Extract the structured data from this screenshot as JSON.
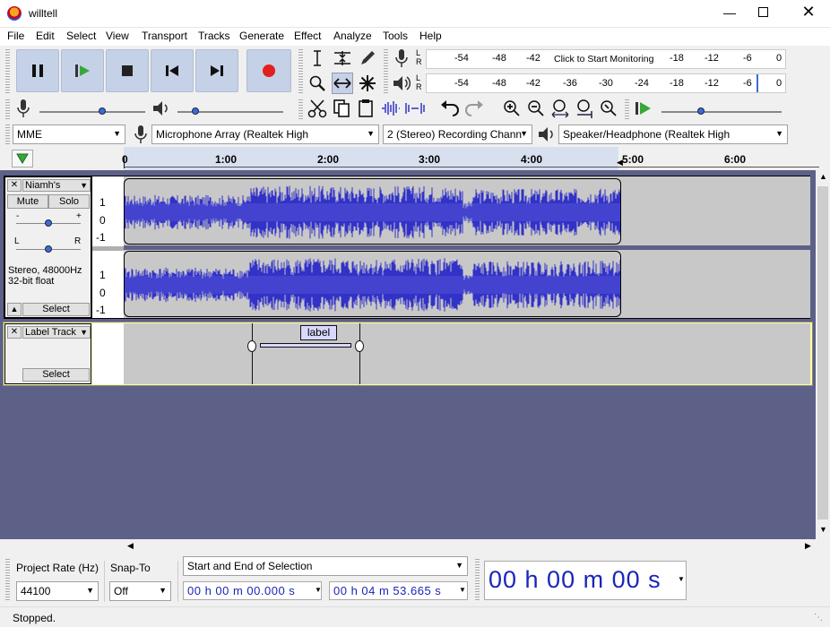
{
  "window": {
    "title": "willtell"
  },
  "menu": [
    "File",
    "Edit",
    "Select",
    "View",
    "Transport",
    "Tracks",
    "Generate",
    "Effect",
    "Analyze",
    "Tools",
    "Help"
  ],
  "meters": {
    "record_ticks": [
      "-54",
      "-48",
      "-42",
      "Click to Start Monitoring",
      "-18",
      "-12",
      "-6",
      "0"
    ],
    "playback_ticks": [
      "-54",
      "-48",
      "-42",
      "-36",
      "-30",
      "-24",
      "-18",
      "-12",
      "-6",
      "0"
    ],
    "channels": [
      "L",
      "R"
    ]
  },
  "devices": {
    "host": "MME",
    "mic": "Microphone Array (Realtek High",
    "channels": "2 (Stereo) Recording Chann",
    "speaker": "Speaker/Headphone (Realtek High"
  },
  "ruler": {
    "labels": [
      "0",
      "1:00",
      "2:00",
      "3:00",
      "4:00",
      "5:00",
      "6:00"
    ]
  },
  "audio_track": {
    "name": "Niamh's",
    "mute": "Mute",
    "solo": "Solo",
    "info1": "Stereo, 48000Hz",
    "info2": "32-bit float",
    "select": "Select",
    "gain_minus": "-",
    "gain_plus": "+",
    "pan_left": "L",
    "pan_right": "R",
    "scale": [
      "1",
      "0",
      "-1"
    ]
  },
  "label_track": {
    "name": "Label Track",
    "select": "Select",
    "label_text": "label"
  },
  "selection": {
    "rate_label": "Project Rate (Hz)",
    "rate": "44100",
    "snap_label": "Snap-To",
    "snap": "Off",
    "mode": "Start and End of Selection",
    "start": "00 h 00 m 00.000 s",
    "end": "00 h 04 m 53.665 s",
    "audio_pos": "00 h 00 m 00 s"
  },
  "status": "Stopped.",
  "colors": {
    "waveform": "#3232c8",
    "waveform_bg": "#c8c8c8",
    "track_bg": "#5d6187",
    "label_sel": "#ffffcc",
    "timecode": "#1a26b8"
  }
}
